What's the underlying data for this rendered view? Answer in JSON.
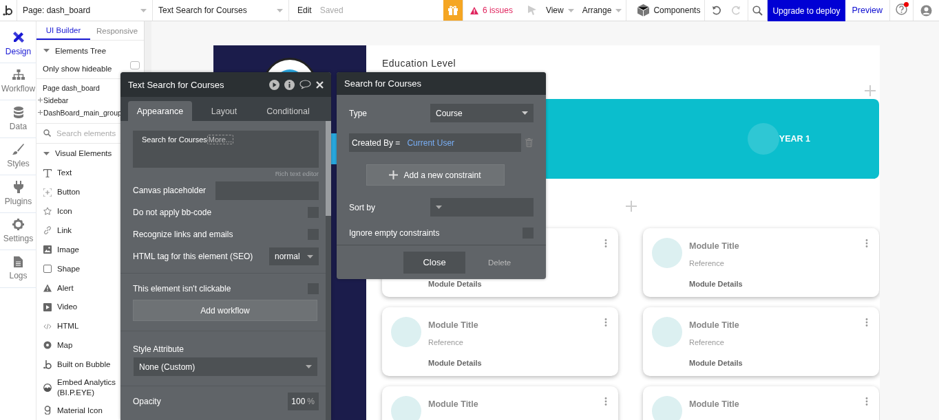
{
  "topbar": {
    "page_selector": "Page: dash_board",
    "element_selector": "Text Search for Courses",
    "edit_link": "Edit",
    "save_status": "Saved",
    "issues": "6 issues",
    "menus": [
      "View",
      "Arrange"
    ],
    "components": "Components",
    "upgrade_button": "Upgrade to deploy",
    "preview_link": "Preview",
    "help_notification": true
  },
  "rail": [
    {
      "label": "Design",
      "selected": true
    },
    {
      "label": "Workflow",
      "selected": false
    },
    {
      "label": "Data",
      "selected": false
    },
    {
      "label": "Styles",
      "selected": false
    },
    {
      "label": "Plugins",
      "selected": false
    },
    {
      "label": "Settings",
      "selected": false
    },
    {
      "label": "Logs",
      "selected": false
    }
  ],
  "elements_panel": {
    "tabs": [
      {
        "label": "UI Builder",
        "selected": true
      },
      {
        "label": "Responsive",
        "selected": false
      }
    ],
    "tree_heading": "Elements Tree",
    "hideable_label": "Only show hideable",
    "hideable_checked": false,
    "tree": [
      {
        "label": "Page dash_board",
        "children": [
          {
            "label": "Sidebar",
            "expanded": false
          },
          {
            "label": "DashBoard_main_group",
            "expanded": false
          }
        ]
      }
    ],
    "search_placeholder": "Search elements",
    "section_heading": "Visual Elements",
    "items": [
      "Text",
      "Button",
      "Icon",
      "Link",
      "Image",
      "Shape",
      "Alert",
      "Video",
      "HTML",
      "Map",
      "Built on Bubble",
      "Embed Analytics (BI.P.EYE)",
      "Material Icon"
    ]
  },
  "canvas": {
    "heading": "Education Level",
    "banner_label": "YEAR 1",
    "card_rows": [
      {
        "cards": [
          {
            "details": "Module Details"
          },
          {
            "title": "Module Title",
            "reference": "Reference",
            "details": "Module Details"
          }
        ]
      },
      {
        "cards": [
          {
            "title": "Module Title",
            "reference": "Reference",
            "details": "Module Details"
          },
          {
            "title": "Module Title",
            "reference": "Reference",
            "details": "Module Details"
          }
        ]
      },
      {
        "cards": [
          {
            "title": "Module Title"
          },
          {
            "title": "Module Title"
          }
        ]
      }
    ]
  },
  "property_panel": {
    "title": "Text Search for Courses",
    "tabs": [
      {
        "label": "Appearance",
        "selected": true
      },
      {
        "label": "Layout",
        "selected": false
      },
      {
        "label": "Conditional",
        "selected": false
      }
    ],
    "content_text": "Search for Courses",
    "more_tag": "More...",
    "rich_text_link": "Rich text editor",
    "rows": [
      {
        "kind": "input",
        "label": "Canvas placeholder"
      },
      {
        "kind": "checkbox",
        "label": "Do not apply bb-code",
        "checked": false
      },
      {
        "kind": "checkbox",
        "label": "Recognize links and emails",
        "checked": false
      },
      {
        "kind": "select",
        "label": "HTML tag for this element (SEO)",
        "value": "normal"
      },
      {
        "kind": "divider"
      },
      {
        "kind": "checkbox",
        "label": "This element isn't clickable",
        "checked": false
      },
      {
        "kind": "button",
        "label": "Add workflow"
      },
      {
        "kind": "divider"
      },
      {
        "kind": "heading",
        "label": "Style Attribute"
      },
      {
        "kind": "wideselect",
        "value": "None (Custom)"
      },
      {
        "kind": "divider"
      },
      {
        "kind": "number",
        "label": "Opacity",
        "value": "100",
        "unit": "%"
      }
    ]
  },
  "search_popup": {
    "title": "Search for Courses",
    "type_label": "Type",
    "type_value": "Course",
    "constraint_field": "Created By =",
    "constraint_value": "Current User",
    "add_constraint": "Add a new constraint",
    "sort_label": "Sort by",
    "ignore_label": "Ignore empty constraints",
    "ignore_checked": false,
    "close_button": "Close",
    "delete_button": "Delete"
  }
}
